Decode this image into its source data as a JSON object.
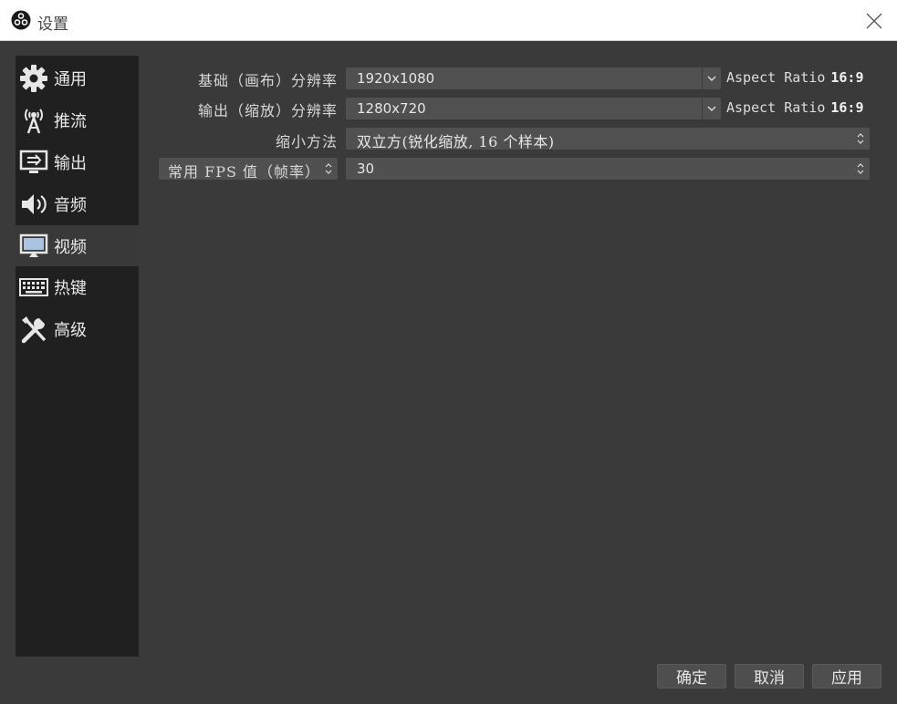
{
  "window": {
    "title": "设置"
  },
  "sidebar": {
    "items": [
      {
        "label": "通用",
        "icon": "gear-icon"
      },
      {
        "label": "推流",
        "icon": "antenna-icon"
      },
      {
        "label": "输出",
        "icon": "monitor-output-icon"
      },
      {
        "label": "音频",
        "icon": "speaker-icon"
      },
      {
        "label": "视频",
        "icon": "monitor-icon",
        "selected": true
      },
      {
        "label": "热键",
        "icon": "keyboard-icon"
      },
      {
        "label": "高级",
        "icon": "tools-icon"
      }
    ]
  },
  "video": {
    "base_resolution": {
      "label": "基础（画布）分辨率",
      "value": "1920x1080",
      "aspect_label": "Aspect Ratio",
      "aspect_value": "16:9"
    },
    "output_resolution": {
      "label": "输出（缩放）分辨率",
      "value": "1280x720",
      "aspect_label": "Aspect Ratio",
      "aspect_value": "16:9"
    },
    "downscale_filter": {
      "label": "缩小方法",
      "value": "双立方(锐化缩放, 16 个样本)"
    },
    "fps": {
      "type_label": "常用 FPS 值（帧率）",
      "value": "30"
    }
  },
  "buttons": {
    "ok": "确定",
    "cancel": "取消",
    "apply": "应用"
  },
  "colors": {
    "background": "#3a3a3a",
    "sidebar": "#202020",
    "selected": "#393939",
    "field": "#505050"
  }
}
